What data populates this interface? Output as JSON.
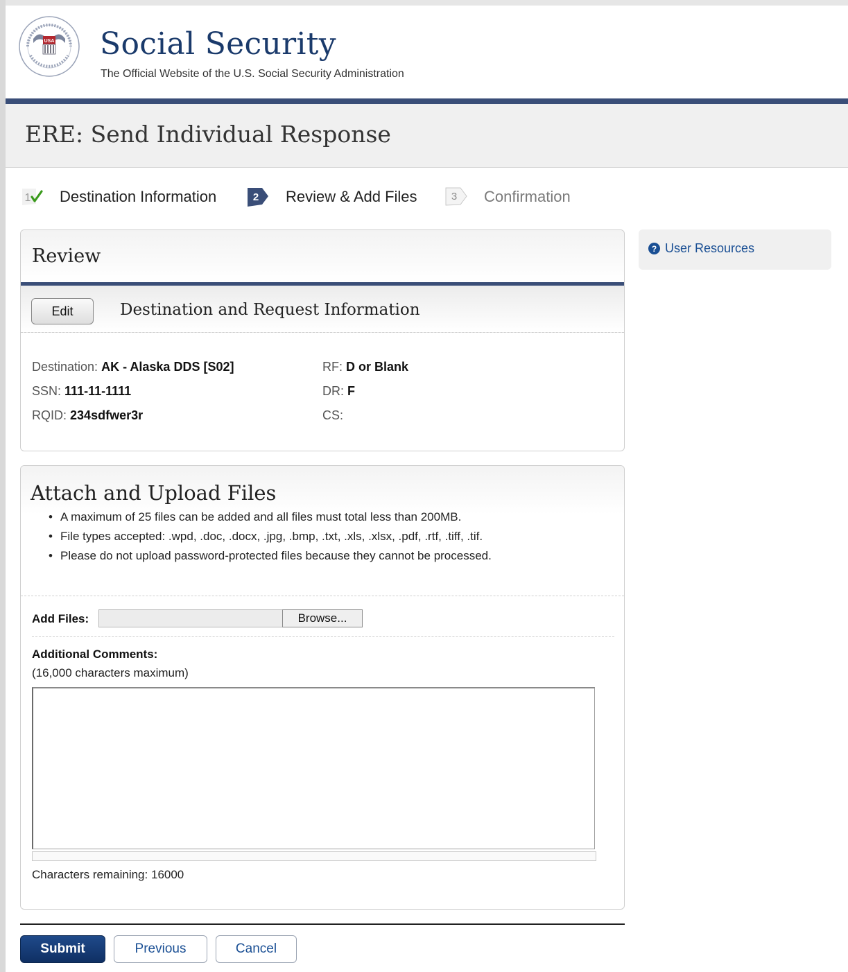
{
  "header": {
    "title": "Social Security",
    "subtitle": "The Official Website of the U.S. Social Security Administration",
    "seal_text": "USA"
  },
  "page": {
    "title": "ERE: Send Individual Response"
  },
  "stepper": {
    "steps": [
      {
        "number": "1",
        "label": "Destination Information",
        "state": "complete"
      },
      {
        "number": "2",
        "label": "Review & Add Files",
        "state": "current"
      },
      {
        "number": "3",
        "label": "Confirmation",
        "state": "upcoming"
      }
    ]
  },
  "review": {
    "title": "Review",
    "edit_label": "Edit",
    "section_title": "Destination and Request Information",
    "fields": {
      "destination": {
        "label": "Destination:",
        "value": "AK - Alaska DDS [S02]"
      },
      "ssn": {
        "label": "SSN:",
        "value": "111-11-1111"
      },
      "rqid": {
        "label": "RQID:",
        "value": "234sdfwer3r"
      },
      "rf": {
        "label": "RF:",
        "value": "D or Blank"
      },
      "dr": {
        "label": "DR:",
        "value": "F"
      },
      "cs": {
        "label": "CS:",
        "value": ""
      }
    }
  },
  "upload": {
    "title": "Attach and Upload Files",
    "bullets": [
      "A maximum of 25 files can be added and all files must total less than 200MB.",
      "File types accepted: .wpd, .doc, .docx, .jpg, .bmp, .txt, .xls, .xlsx, .pdf, .rtf, .tiff, .tif.",
      "Please do not upload password-protected files because they cannot be processed."
    ],
    "add_files_label": "Add Files:",
    "browse_label": "Browse...",
    "comments_label": "Additional Comments:",
    "comments_hint": "(16,000 characters maximum)",
    "comments_value": "",
    "chars_remaining_label": "Characters remaining:",
    "chars_remaining_value": "16000"
  },
  "actions": {
    "submit": "Submit",
    "previous": "Previous",
    "cancel": "Cancel"
  },
  "sidebar": {
    "user_resources": "User Resources",
    "icon": "question-circle-icon"
  },
  "colors": {
    "brand_navy": "#1a3a6b",
    "rule_blue": "#3a4e78",
    "link_blue": "#1a4f94",
    "complete_check": "#3a9a1c"
  }
}
